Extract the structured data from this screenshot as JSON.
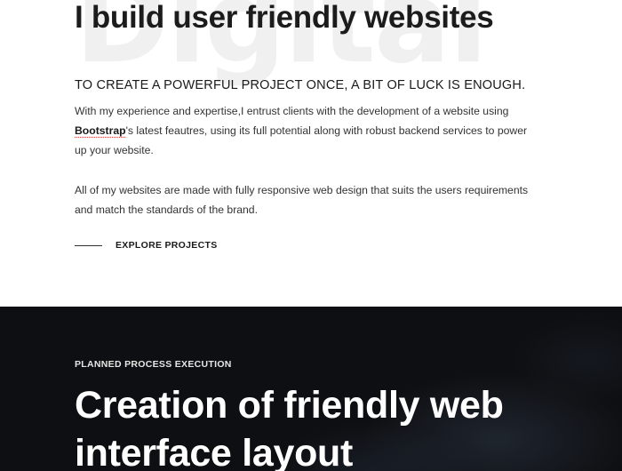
{
  "about": {
    "background_word": "Digital",
    "heading": "I build user friendly websites",
    "subheading": "TO CREATE A POWERFUL PROJECT ONCE, A BIT OF LUCK IS ENOUGH.",
    "paragraph1_before": "With my experience and expertise,I entrust clients with the development of a website using ",
    "paragraph1_link": "Bootstrap",
    "paragraph1_after": "'s latest feautres, using its full potential along with robust backend services to power up your website.",
    "paragraph2": "All of my websites are made with fully responsive web design that suits the users requirements and match the standards of the brand.",
    "explore_label": "EXPLORE PROJECTS"
  },
  "process": {
    "overline": "PLANNED PROCESS EXECUTION",
    "heading": "Creation of friendly web interface layout"
  },
  "colors": {
    "dark_section": "#0e0f12",
    "background_word": "#f0f0f0",
    "spellcheck_underline": "#e05050"
  }
}
